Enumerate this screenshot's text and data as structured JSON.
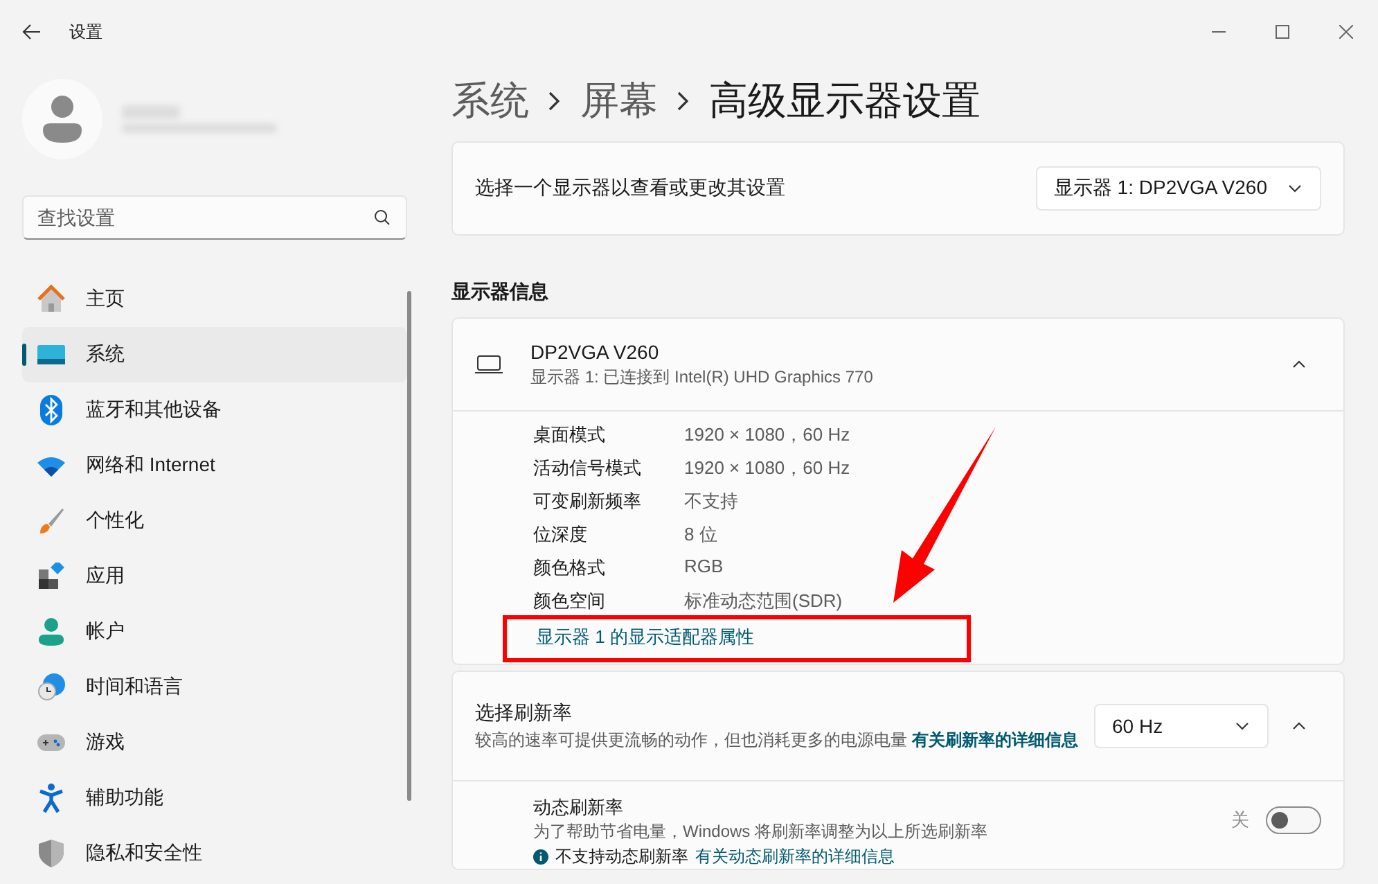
{
  "window": {
    "title": "设置"
  },
  "search": {
    "placeholder": "查找设置"
  },
  "nav": [
    {
      "label": "主页",
      "selected": false
    },
    {
      "label": "系统",
      "selected": true
    },
    {
      "label": "蓝牙和其他设备",
      "selected": false
    },
    {
      "label": "网络和 Internet",
      "selected": false
    },
    {
      "label": "个性化",
      "selected": false
    },
    {
      "label": "应用",
      "selected": false
    },
    {
      "label": "帐户",
      "selected": false
    },
    {
      "label": "时间和语言",
      "selected": false
    },
    {
      "label": "游戏",
      "selected": false
    },
    {
      "label": "辅助功能",
      "selected": false
    },
    {
      "label": "隐私和安全性",
      "selected": false
    }
  ],
  "breadcrumb": [
    "系统",
    "屏幕",
    "高级显示器设置"
  ],
  "display_select": {
    "label": "选择一个显示器以查看或更改其设置",
    "value": "显示器 1: DP2VGA V260"
  },
  "section_title": "显示器信息",
  "display_info": {
    "name": "DP2VGA V260",
    "subtitle": "显示器 1: 已连接到 Intel(R) UHD Graphics 770",
    "expanded": true,
    "rows": [
      {
        "label": "桌面模式",
        "value": "1920 × 1080，60 Hz"
      },
      {
        "label": "活动信号模式",
        "value": "1920 × 1080，60 Hz"
      },
      {
        "label": "可变刷新频率",
        "value": "不支持"
      },
      {
        "label": "位深度",
        "value": "8 位"
      },
      {
        "label": "颜色格式",
        "value": "RGB"
      },
      {
        "label": "颜色空间",
        "value": "标准动态范围(SDR)"
      }
    ],
    "link": "显示器 1 的显示适配器属性"
  },
  "refresh_rate": {
    "title": "选择刷新率",
    "description": "较高的速率可提供更流畅的动作，但也消耗更多的电源电量",
    "link": "有关刷新率的详细信息",
    "value": "60 Hz",
    "expanded": true,
    "dynamic": {
      "title": "动态刷新率",
      "description": "为了帮助节省电量，Windows 将刷新率调整为以上所选刷新率",
      "state_label": "关",
      "on": false,
      "note": "不支持动态刷新率",
      "note_link": "有关动态刷新率的详细信息"
    }
  }
}
